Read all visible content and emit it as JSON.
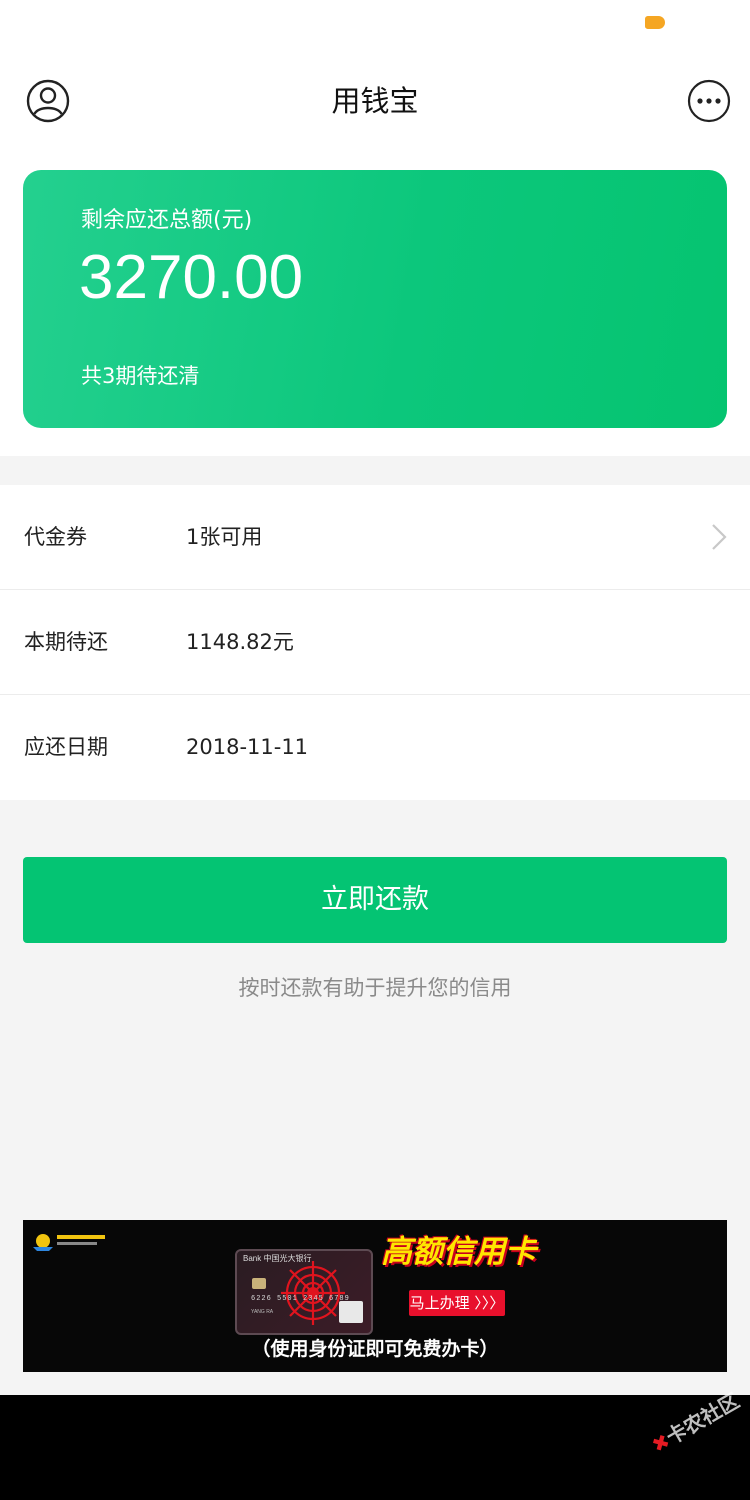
{
  "header": {
    "title": "用钱宝",
    "avatar_icon": "user-circle-icon",
    "more_icon": "more-circle-icon"
  },
  "summary": {
    "label": "剩余应还总额(元)",
    "amount": "3270.00",
    "periods": "共3期待还清"
  },
  "details": [
    {
      "label": "代金券",
      "value": "1张可用",
      "has_arrow": true
    },
    {
      "label": "本期待还",
      "value": "1148.82元",
      "has_arrow": false
    },
    {
      "label": "应还日期",
      "value": "2018-11-11",
      "has_arrow": false
    }
  ],
  "actions": {
    "repay_label": "立即还款",
    "hint": "按时还款有助于提升您的信用"
  },
  "banner": {
    "headline": "高额信用卡",
    "cta": "马上办理 〉〉〉",
    "subtitle": "（使用身份证即可免费办卡）",
    "card_bank": "Bank 中国光大银行",
    "card_number": "6226 5501 2345 6789",
    "card_holder": "YANG RA"
  },
  "watermark": "卡农社区",
  "colors": {
    "primary": "#04c473",
    "card_gradient_start": "#24d08f",
    "card_gradient_end": "#05c470",
    "status_indicator": "#f5a623"
  }
}
